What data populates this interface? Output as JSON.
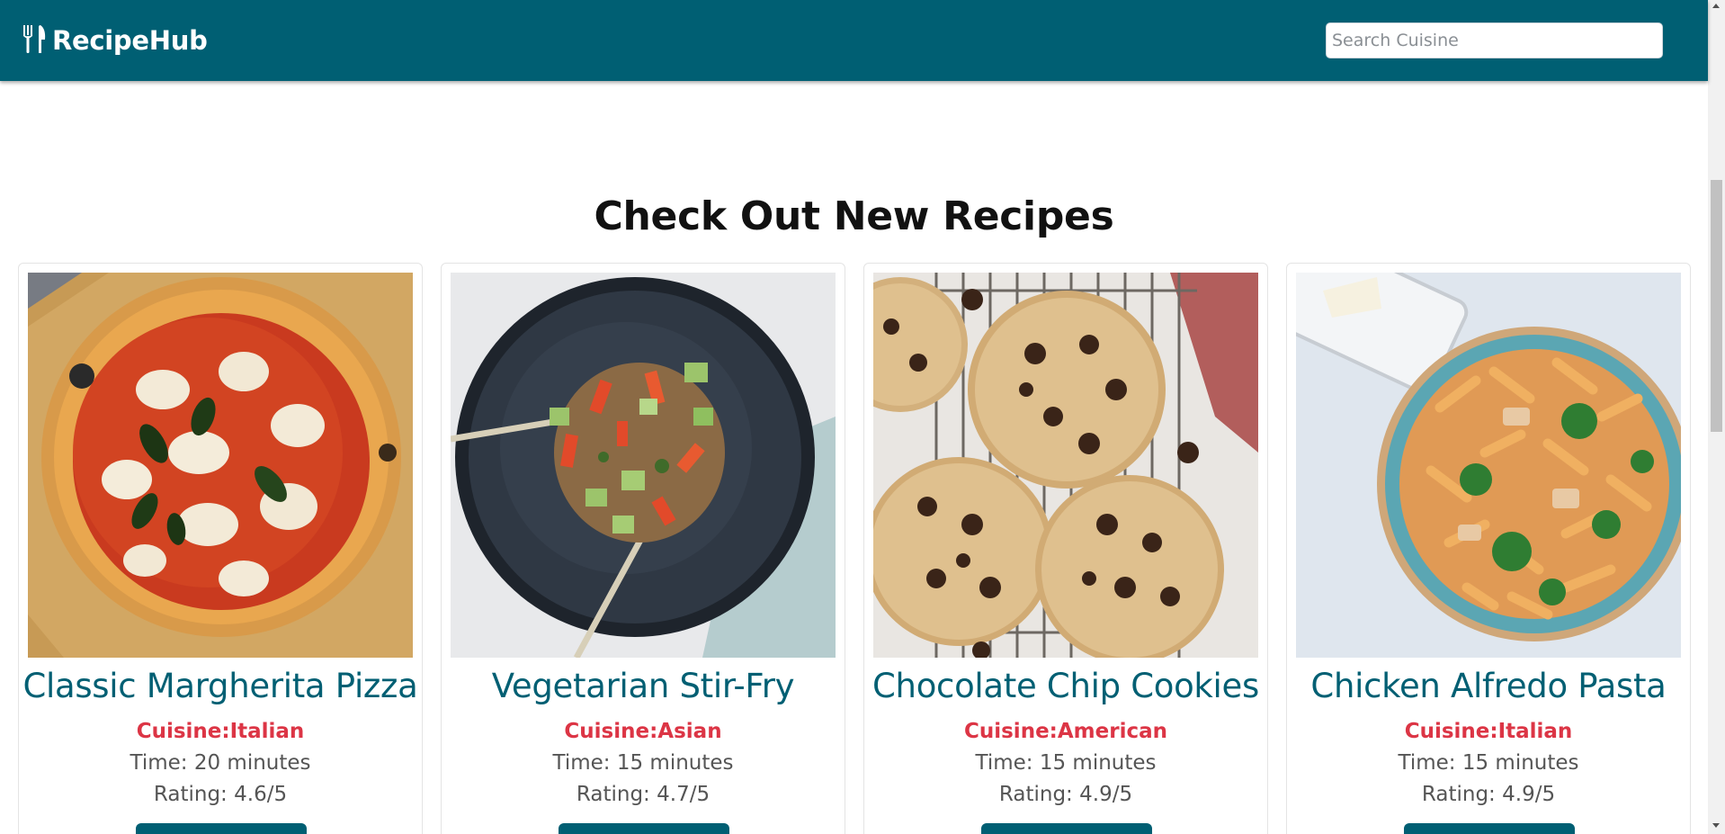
{
  "brand": {
    "name": "RecipeHub",
    "icon": "utensils-icon"
  },
  "search": {
    "placeholder": "Search Cuisine",
    "value": ""
  },
  "section": {
    "title": "Check Out New Recipes"
  },
  "recipes": [
    {
      "title": "Classic Margherita Pizza",
      "cuisine": "Cuisine:Italian",
      "time": "Time: 20 minutes",
      "rating": "Rating: 4.6/5",
      "image": "pizza-photo"
    },
    {
      "title": "Vegetarian Stir-Fry",
      "cuisine": "Cuisine:Asian",
      "time": "Time: 15 minutes",
      "rating": "Rating: 4.7/5",
      "image": "stir-fry-photo"
    },
    {
      "title": "Chocolate Chip Cookies",
      "cuisine": "Cuisine:American",
      "time": "Time: 15 minutes",
      "rating": "Rating: 4.9/5",
      "image": "cookies-photo"
    },
    {
      "title": "Chicken Alfredo Pasta",
      "cuisine": "Cuisine:Italian",
      "time": "Time: 15 minutes",
      "rating": "Rating: 4.9/5",
      "image": "pasta-photo"
    }
  ],
  "colors": {
    "nav": "#005f73",
    "title": "#005f73",
    "cuisine": "#dc3545",
    "button": "#005f73"
  }
}
